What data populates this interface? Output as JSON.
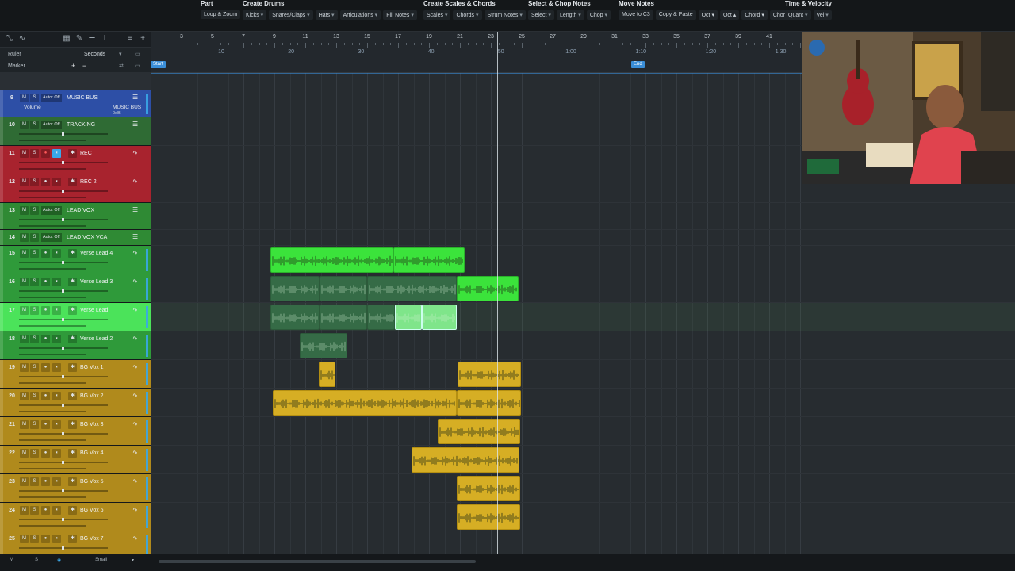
{
  "toolbar": {
    "groups": [
      {
        "title": "Part",
        "buttons": [
          {
            "label": "Loop & Zoom",
            "dd": false
          }
        ]
      },
      {
        "title": "Create Drums",
        "buttons": [
          {
            "label": "Kicks",
            "dd": true
          },
          {
            "label": "Snares/Claps",
            "dd": true
          },
          {
            "label": "Hats",
            "dd": true
          },
          {
            "label": "Articulations",
            "dd": true
          },
          {
            "label": "Fill Notes",
            "dd": true
          }
        ]
      },
      {
        "title": "Create Scales & Chords",
        "buttons": [
          {
            "label": "Scales",
            "dd": true
          },
          {
            "label": "Chords",
            "dd": true
          },
          {
            "label": "Strum Notes",
            "dd": true
          }
        ]
      },
      {
        "title": "Select & Chop Notes",
        "buttons": [
          {
            "label": "Select",
            "dd": true
          },
          {
            "label": "Length",
            "dd": true
          },
          {
            "label": "Chop",
            "dd": true
          }
        ]
      },
      {
        "title": "Move Notes",
        "buttons": [
          {
            "label": "Move to C3",
            "dd": false
          },
          {
            "label": "Copy & Paste",
            "dd": false
          },
          {
            "label": "Oct ▾",
            "dd": false
          },
          {
            "label": "Oct ▴",
            "dd": false
          },
          {
            "label": "Chord ▾",
            "dd": false
          },
          {
            "label": "Chord ▴",
            "dd": false
          }
        ]
      },
      {
        "title": "Time & Velocity",
        "buttons": [
          {
            "label": "Quant",
            "dd": true
          },
          {
            "label": "Vel",
            "dd": true
          }
        ]
      }
    ]
  },
  "ruler_panel": {
    "ruler_label": "Ruler",
    "ruler_format": "Seconds",
    "marker_label": "Marker",
    "add": "+",
    "remove": "−"
  },
  "timeline": {
    "bars": [
      "3",
      "5",
      "7",
      "9",
      "11",
      "13",
      "15",
      "17",
      "19",
      "21",
      "23",
      "25",
      "27",
      "29",
      "31",
      "33",
      "35",
      "37",
      "39",
      "41"
    ],
    "seconds": [
      "10",
      "20",
      "30",
      "40",
      "50",
      "1:00",
      "1:10",
      "1:20",
      "1:30"
    ],
    "start_marker": "Start",
    "end_marker": "End"
  },
  "tracks": [
    {
      "num": "9",
      "name": "MUSIC BUS",
      "type": "folder",
      "color": "#2d4fa6",
      "auto": "Auto: Off",
      "sub": "Volume",
      "extra": "MUSIC BUS",
      "extra2": "0dB"
    },
    {
      "num": "10",
      "name": "TRACKING",
      "type": "folder",
      "color": "#2f6b34",
      "auto": "Auto: Off"
    },
    {
      "num": "11",
      "name": "REC",
      "type": "audio",
      "color": "#a8232e"
    },
    {
      "num": "12",
      "name": "REC 2",
      "type": "audio",
      "color": "#a8232e"
    },
    {
      "num": "13",
      "name": "LEAD VOX",
      "type": "folder",
      "color": "#2f8a34",
      "auto": "Auto: Off"
    },
    {
      "num": "14",
      "name": "LEAD VOX VCA",
      "type": "folder",
      "color": "#2f8a34",
      "auto": "Auto: Off"
    },
    {
      "num": "15",
      "name": "Verse Lead 4",
      "type": "audio",
      "color": "#2f9a3a"
    },
    {
      "num": "16",
      "name": "Verse Lead 3",
      "type": "audio",
      "color": "#2f9a3a"
    },
    {
      "num": "17",
      "name": "Verse Lead",
      "type": "audio",
      "color": "#4be35a"
    },
    {
      "num": "18",
      "name": "Verse Lead 2",
      "type": "audio",
      "color": "#2f9a3a"
    },
    {
      "num": "19",
      "name": "BG Vox 1",
      "type": "audio",
      "color": "#b08a1c"
    },
    {
      "num": "20",
      "name": "BG Vox 2",
      "type": "audio",
      "color": "#b08a1c"
    },
    {
      "num": "21",
      "name": "BG Vox 3",
      "type": "audio",
      "color": "#b08a1c"
    },
    {
      "num": "22",
      "name": "BG Vox 4",
      "type": "audio",
      "color": "#b08a1c"
    },
    {
      "num": "23",
      "name": "BG Vox 5",
      "type": "audio",
      "color": "#b08a1c"
    },
    {
      "num": "24",
      "name": "BG Vox 6",
      "type": "audio",
      "color": "#b08a1c"
    },
    {
      "num": "25",
      "name": "BG Vox 7",
      "type": "audio",
      "color": "#b08a1c"
    }
  ],
  "bottom": {
    "m": "M",
    "s": "S",
    "size": "Small"
  }
}
